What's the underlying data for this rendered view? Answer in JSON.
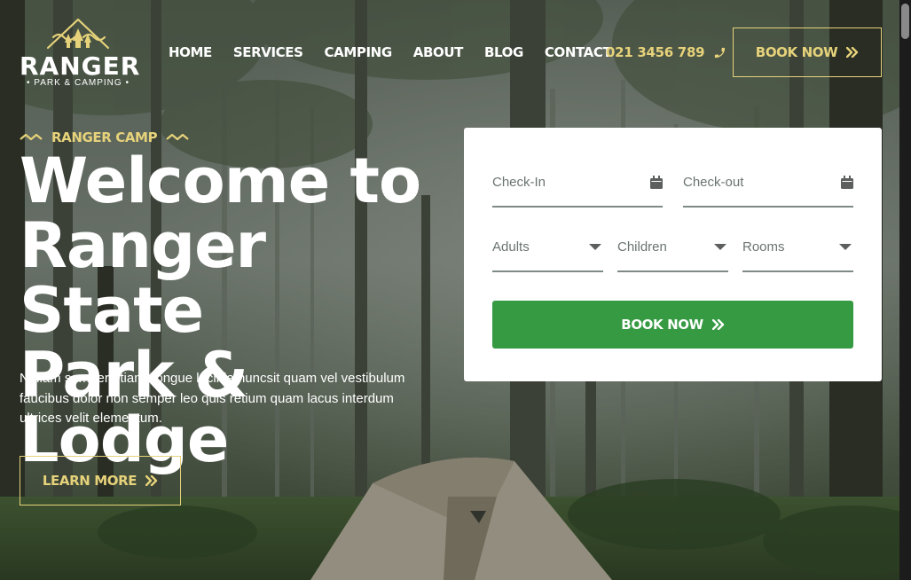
{
  "brand": {
    "name": "RANGER",
    "subtitle": "• PARK & CAMPING •"
  },
  "nav": {
    "items": [
      "HOME",
      "SERVICES",
      "CAMPING",
      "ABOUT",
      "BLOG",
      "CONTACT"
    ]
  },
  "header": {
    "phone": "021 3456 789",
    "book_label": "BOOK NOW"
  },
  "hero": {
    "tagline": "RANGER CAMP",
    "title_line1": "Welcome to",
    "title_line2": "Ranger State",
    "title_line3": "Park & Lodge",
    "description": "Nullam semper etiam congue lacinia nuncsit quam vel vestibulum faucibus dolor non semper leo quis retium quam lacus interdum ultrices velit elementum.",
    "cta_label": "LEARN MORE"
  },
  "booking_form": {
    "checkin_placeholder": "Check-In",
    "checkout_placeholder": "Check-out",
    "adults_label": "Adults",
    "children_label": "Children",
    "rooms_label": "Rooms",
    "submit_label": "BOOK NOW"
  },
  "colors": {
    "accent_gold": "#e6d27a",
    "button_green": "#359a42",
    "field_border": "#7e8a86"
  }
}
